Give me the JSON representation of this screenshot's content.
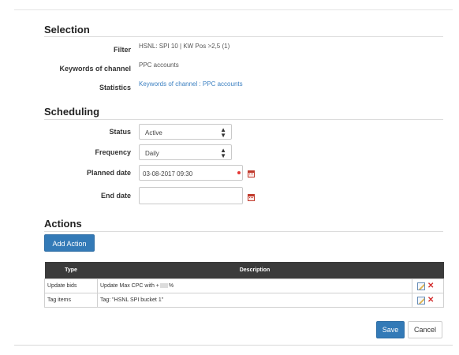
{
  "selection": {
    "title": "Selection",
    "filter_label": "Filter",
    "filter_value": "HSNL: SPI 10 | KW Pos >2,5 (1)",
    "keywords_label": "Keywords of channel",
    "keywords_value": "PPC accounts",
    "statistics_label": "Statistics",
    "statistics_link": "Keywords of channel : PPC accounts"
  },
  "scheduling": {
    "title": "Scheduling",
    "status_label": "Status",
    "status_value": "Active",
    "frequency_label": "Frequency",
    "frequency_value": "Daily",
    "planned_label": "Planned date",
    "planned_value": "03-08-2017 09:30",
    "end_label": "End date",
    "end_value": ""
  },
  "actions": {
    "title": "Actions",
    "add_button": "Add Action",
    "columns": [
      "Type",
      "Description"
    ],
    "rows": [
      {
        "type": "Update bids",
        "desc_prefix": "Update Max CPC with +",
        "desc_suffix": "%"
      },
      {
        "type": "Tag items",
        "desc_prefix": "Tag: \"HSNL SPI bucket 1\"",
        "desc_suffix": ""
      }
    ]
  },
  "footer": {
    "save": "Save",
    "cancel": "Cancel"
  },
  "icons": {
    "select_arrows": "sort-arrows-icon",
    "calendar": "calendar-icon",
    "edit": "edit-icon",
    "delete": "delete-icon"
  },
  "colors": {
    "primary": "#337ab7",
    "table_header": "#3b3b3b",
    "link": "#3a7fc1",
    "required": "#e53935"
  }
}
